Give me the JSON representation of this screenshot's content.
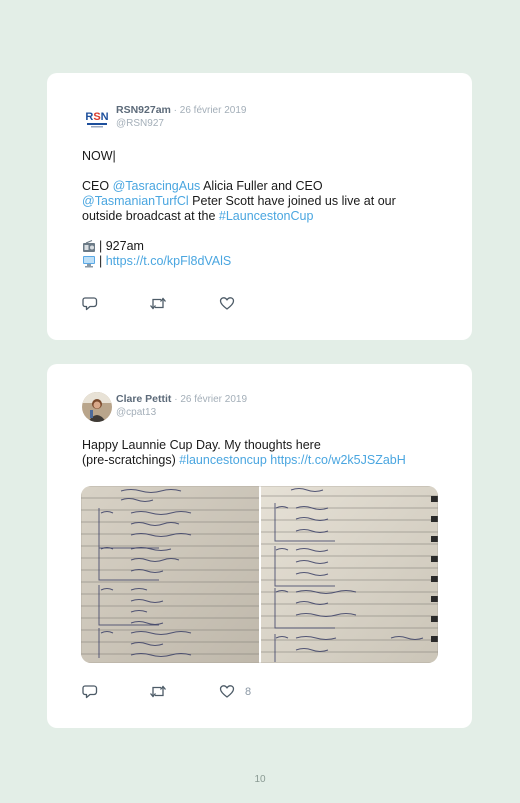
{
  "tweets": [
    {
      "name": "RSN927am",
      "date": "· 26 février 2019",
      "handle": "@RSN927",
      "avatar": "rsn-logo",
      "line1": "NOW|",
      "p2_a": "CEO ",
      "p2_link1": "@TasracingAus",
      "p2_b": " Alicia Fuller and CEO",
      "p2_link2": "@TasmanianTurfCl",
      "p2_c": " Peter Scott have joined us live at our",
      "p2_d": "outside broadcast at the ",
      "p2_link3": "#LauncestonCup",
      "radio_line": "| 927am",
      "url_line": "https://t.co/kpFl8dVAlS",
      "actions": {
        "reply_icon": "reply-icon",
        "retweet_icon": "retweet-icon",
        "like_icon": "heart-icon"
      }
    },
    {
      "name": "Clare Pettit",
      "date": "· 26 février 2019",
      "handle": "@cpat13",
      "avatar": "user-photo",
      "line1": "Happy Launnie Cup Day. My thoughts here",
      "line2_a": "(pre-scratchings) ",
      "line2_link1": "#launcestoncup",
      "line2_link2": " https://t.co/w2k5JSZabH",
      "media": "photo-of-handwritten-race-tips-notebook",
      "like_count": "8",
      "actions": {
        "reply_icon": "reply-icon",
        "retweet_icon": "retweet-icon",
        "like_icon": "heart-icon"
      }
    }
  ],
  "page_number": "10",
  "colors": {
    "background": "#e3eee7",
    "card": "#ffffff",
    "link": "#4aa6e0",
    "name": "#5c6a79",
    "muted": "#a3aeb8"
  }
}
